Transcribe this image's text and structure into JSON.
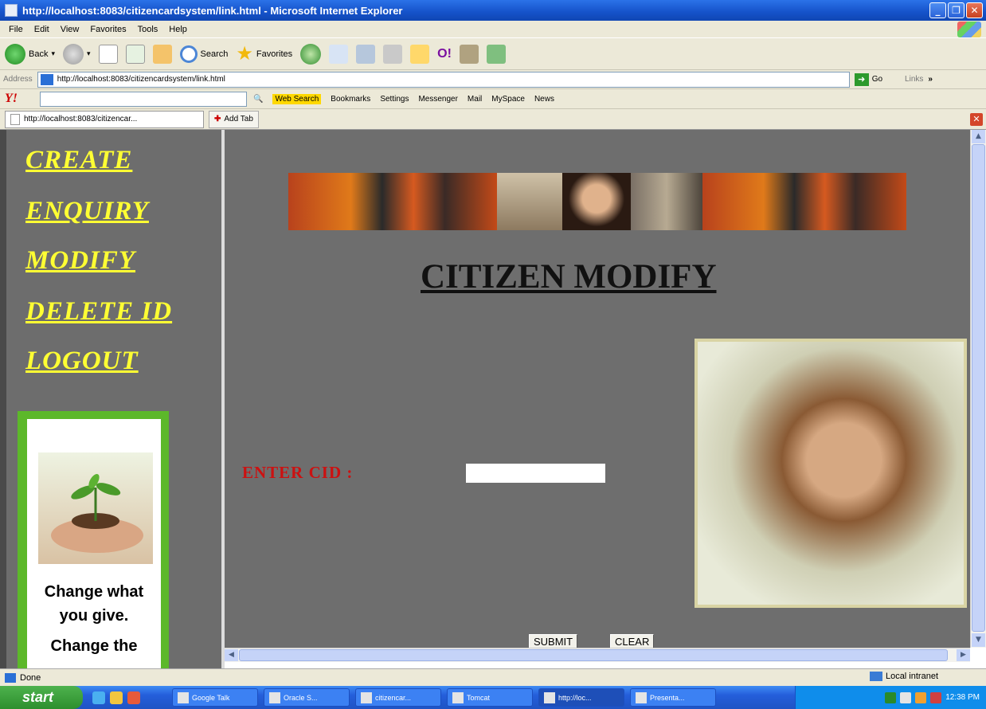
{
  "window": {
    "title": "http://localhost:8083/citizencardsystem/link.html - Microsoft Internet Explorer",
    "minimize": "_",
    "maximize": "❐",
    "close": "✕"
  },
  "menu": [
    "File",
    "Edit",
    "View",
    "Favorites",
    "Tools",
    "Help"
  ],
  "toolbar": {
    "back": "Back",
    "search": "Search",
    "favorites": "Favorites"
  },
  "address": {
    "label": "Address",
    "url": "http://localhost:8083/citizencardsystem/link.html",
    "go": "Go",
    "links": "Links",
    "more": "»"
  },
  "yahoo": {
    "logo": "Y!",
    "search_icon": "🔍",
    "web_search": "Web Search",
    "bookmarks": "Bookmarks",
    "settings": "Settings",
    "messenger": "Messenger",
    "mail": "Mail",
    "myspace": "MySpace",
    "news": "News"
  },
  "tabs": {
    "active": "http://localhost:8083/citizencar...",
    "add": "Add Tab",
    "close": "✕"
  },
  "nav": {
    "create": "CREATE",
    "enquiry": "ENQUIRY",
    "modify": "MODIFY",
    "delete": "DELETE ID",
    "logout": "LOGOUT"
  },
  "ad": {
    "line1": "Change what",
    "line2": "you give.",
    "line3": "Change the"
  },
  "page": {
    "title": "CITIZEN MODIFY",
    "cid_label": "ENTER CID :",
    "submit": "SUBMIT",
    "clear": "CLEAR"
  },
  "scroll": {
    "up": "▲",
    "down": "▼",
    "left": "◀",
    "right": "▶"
  },
  "status": {
    "text": "Done",
    "zone": "Local intranet"
  },
  "taskbar": {
    "start": "start",
    "tasks": [
      "Google Talk",
      "Oracle S...",
      "citizencar...",
      "Tomcat",
      "http://loc...",
      "Presenta..."
    ],
    "clock": "12:38 PM"
  }
}
